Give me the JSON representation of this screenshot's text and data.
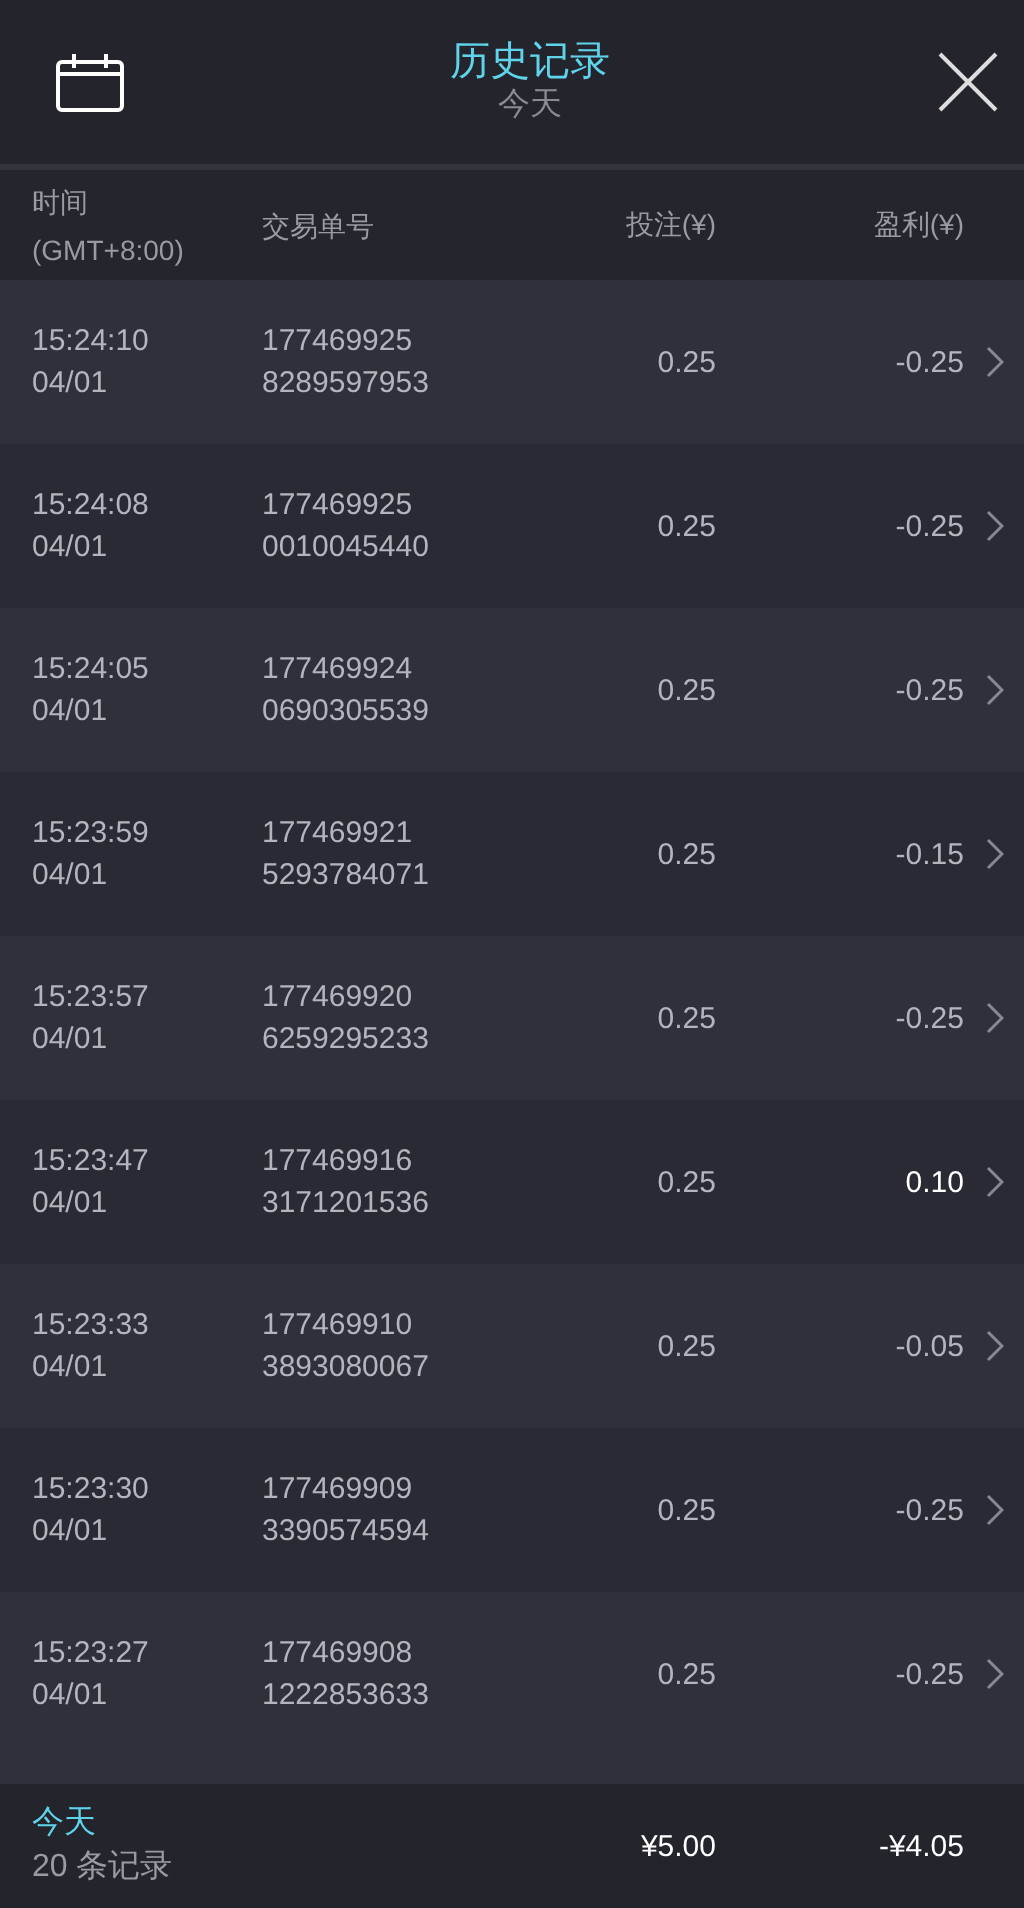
{
  "header": {
    "title": "历史记录",
    "subtitle": "今天"
  },
  "columns": {
    "time": "时间",
    "timezone": "(GMT+8:00)",
    "order_id": "交易单号",
    "stake": "投注(¥)",
    "profit": "盈利(¥)"
  },
  "rows": [
    {
      "time": "15:24:10",
      "date": "04/01",
      "id_1": "177469925",
      "id_2": "8289597953",
      "stake": "0.25",
      "profit": "-0.25",
      "positive": false
    },
    {
      "time": "15:24:08",
      "date": "04/01",
      "id_1": "177469925",
      "id_2": "0010045440",
      "stake": "0.25",
      "profit": "-0.25",
      "positive": false
    },
    {
      "time": "15:24:05",
      "date": "04/01",
      "id_1": "177469924",
      "id_2": "0690305539",
      "stake": "0.25",
      "profit": "-0.25",
      "positive": false
    },
    {
      "time": "15:23:59",
      "date": "04/01",
      "id_1": "177469921",
      "id_2": "5293784071",
      "stake": "0.25",
      "profit": "-0.15",
      "positive": false
    },
    {
      "time": "15:23:57",
      "date": "04/01",
      "id_1": "177469920",
      "id_2": "6259295233",
      "stake": "0.25",
      "profit": "-0.25",
      "positive": false
    },
    {
      "time": "15:23:47",
      "date": "04/01",
      "id_1": "177469916",
      "id_2": "3171201536",
      "stake": "0.25",
      "profit": "0.10",
      "positive": true
    },
    {
      "time": "15:23:33",
      "date": "04/01",
      "id_1": "177469910",
      "id_2": "3893080067",
      "stake": "0.25",
      "profit": "-0.05",
      "positive": false
    },
    {
      "time": "15:23:30",
      "date": "04/01",
      "id_1": "177469909",
      "id_2": "3390574594",
      "stake": "0.25",
      "profit": "-0.25",
      "positive": false
    },
    {
      "time": "15:23:27",
      "date": "04/01",
      "id_1": "177469908",
      "id_2": "1222853633",
      "stake": "0.25",
      "profit": "-0.25",
      "positive": false
    }
  ],
  "footer": {
    "period": "今天",
    "count": "20 条记录",
    "total_stake": "¥5.00",
    "total_profit": "-¥4.05"
  }
}
